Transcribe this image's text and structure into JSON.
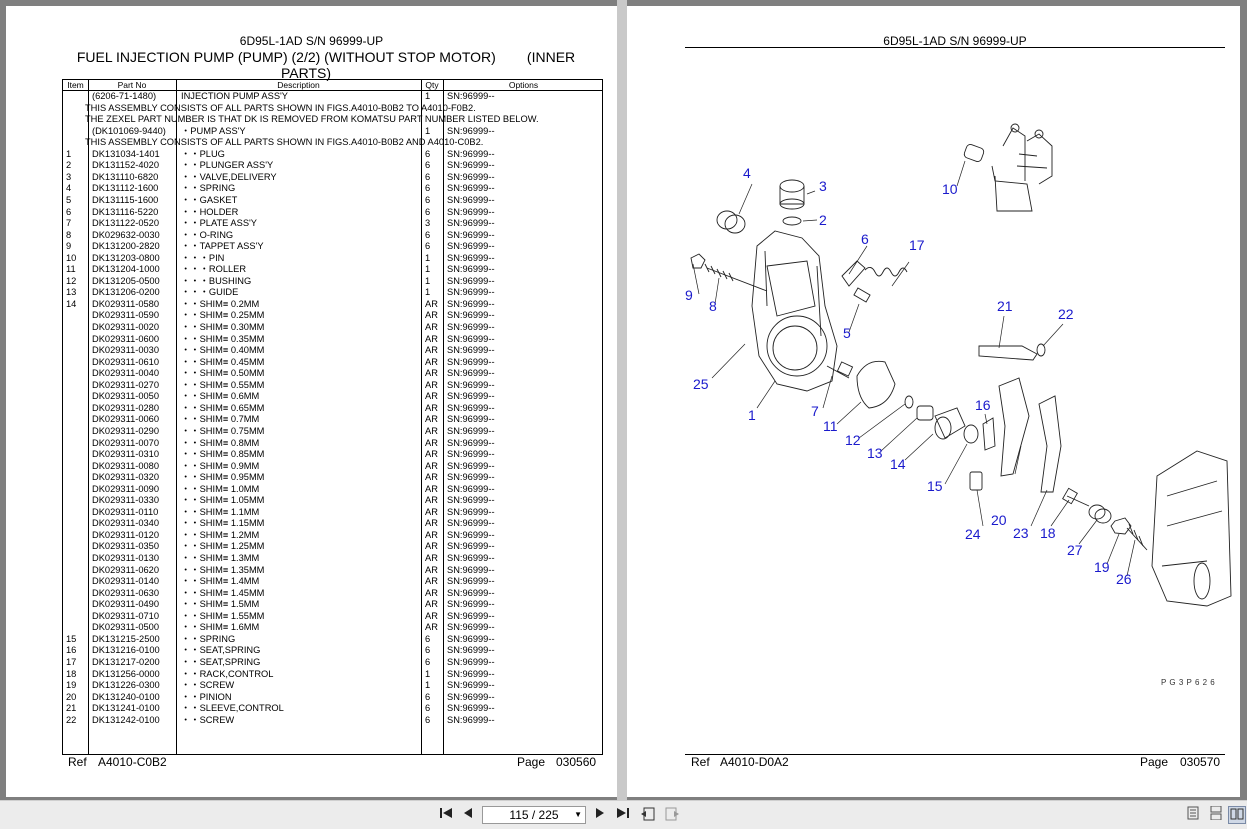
{
  "left_page": {
    "model_header": "6D95L-1AD S/N 96999-UP",
    "title_line1": "FUEL INJECTION PUMP (PUMP) (2/2) (WITHOUT STOP MOTOR)        (INNER",
    "title_line2": "PARTS)",
    "columns": {
      "item": "Item",
      "part_no": "Part No",
      "description": "Description",
      "qty": "Qty",
      "options": "Options"
    },
    "rows": [
      {
        "item": "",
        "part": "(6206-71-1480)",
        "desc": "INJECTION PUMP ASS'Y",
        "qty": "1",
        "opt": "SN:96999--"
      },
      {
        "note": "THIS ASSEMBLY CONSISTS OF ALL PARTS SHOWN IN FIGS.A4010-B0B2 TO A4010-F0B2."
      },
      {
        "note": "THE ZEXEL PART NUMBER IS THAT DK IS REMOVED FROM KOMATSU PART NUMBER LISTED BELOW."
      },
      {
        "item": "",
        "part": "(DK101069-9440)",
        "desc": "・PUMP ASS'Y",
        "qty": "1",
        "opt": "SN:96999--"
      },
      {
        "note": "THIS ASSEMBLY CONSISTS OF ALL PARTS SHOWN IN FIGS.A4010-B0B2 AND A4010-C0B2."
      },
      {
        "item": "1",
        "part": "DK131034-1401",
        "desc": "・・PLUG",
        "qty": "6",
        "opt": "SN:96999--"
      },
      {
        "item": "2",
        "part": "DK131152-4020",
        "desc": "・・PLUNGER ASS'Y",
        "qty": "6",
        "opt": "SN:96999--"
      },
      {
        "item": "3",
        "part": "DK131110-6820",
        "desc": "・・VALVE,DELIVERY",
        "qty": "6",
        "opt": "SN:96999--"
      },
      {
        "item": "4",
        "part": "DK131112-1600",
        "desc": "・・SPRING",
        "qty": "6",
        "opt": "SN:96999--"
      },
      {
        "item": "5",
        "part": "DK131115-1600",
        "desc": "・・GASKET",
        "qty": "6",
        "opt": "SN:96999--"
      },
      {
        "item": "6",
        "part": "DK131116-5220",
        "desc": "・・HOLDER",
        "qty": "6",
        "opt": "SN:96999--"
      },
      {
        "item": "7",
        "part": "DK131122-0520",
        "desc": "・・PLATE ASS'Y",
        "qty": "3",
        "opt": "SN:96999--"
      },
      {
        "item": "8",
        "part": "DK029632-0030",
        "desc": "・・O-RING",
        "qty": "6",
        "opt": "SN:96999--"
      },
      {
        "item": "9",
        "part": "DK131200-2820",
        "desc": "・・TAPPET ASS'Y",
        "qty": "6",
        "opt": "SN:96999--"
      },
      {
        "item": "10",
        "part": "DK131203-0800",
        "desc": "・・・PIN",
        "qty": "1",
        "opt": "SN:96999--"
      },
      {
        "item": "11",
        "part": "DK131204-1000",
        "desc": "・・・ROLLER",
        "qty": "1",
        "opt": "SN:96999--"
      },
      {
        "item": "12",
        "part": "DK131205-0500",
        "desc": "・・・BUSHING",
        "qty": "1",
        "opt": "SN:96999--"
      },
      {
        "item": "13",
        "part": "DK131206-0200",
        "desc": "・・・GUIDE",
        "qty": "1",
        "opt": "SN:96999--"
      },
      {
        "item": "14",
        "part": "DK029311-0580",
        "desc": "・・SHIM≡ 0.2MM",
        "qty": "AR",
        "opt": "SN:96999--"
      },
      {
        "item": "",
        "part": "DK029311-0590",
        "desc": "・・SHIM≡ 0.25MM",
        "qty": "AR",
        "opt": "SN:96999--"
      },
      {
        "item": "",
        "part": "DK029311-0020",
        "desc": "・・SHIM≡ 0.30MM",
        "qty": "AR",
        "opt": "SN:96999--"
      },
      {
        "item": "",
        "part": "DK029311-0600",
        "desc": "・・SHIM≡ 0.35MM",
        "qty": "AR",
        "opt": "SN:96999--"
      },
      {
        "item": "",
        "part": "DK029311-0030",
        "desc": "・・SHIM≡ 0.40MM",
        "qty": "AR",
        "opt": "SN:96999--"
      },
      {
        "item": "",
        "part": "DK029311-0610",
        "desc": "・・SHIM≡ 0.45MM",
        "qty": "AR",
        "opt": "SN:96999--"
      },
      {
        "item": "",
        "part": "DK029311-0040",
        "desc": "・・SHIM≡ 0.50MM",
        "qty": "AR",
        "opt": "SN:96999--"
      },
      {
        "item": "",
        "part": "DK029311-0270",
        "desc": "・・SHIM≡ 0.55MM",
        "qty": "AR",
        "opt": "SN:96999--"
      },
      {
        "item": "",
        "part": "DK029311-0050",
        "desc": "・・SHIM≡ 0.6MM",
        "qty": "AR",
        "opt": "SN:96999--"
      },
      {
        "item": "",
        "part": "DK029311-0280",
        "desc": "・・SHIM≡ 0.65MM",
        "qty": "AR",
        "opt": "SN:96999--"
      },
      {
        "item": "",
        "part": "DK029311-0060",
        "desc": "・・SHIM≡ 0.7MM",
        "qty": "AR",
        "opt": "SN:96999--"
      },
      {
        "item": "",
        "part": "DK029311-0290",
        "desc": "・・SHIM≡ 0.75MM",
        "qty": "AR",
        "opt": "SN:96999--"
      },
      {
        "item": "",
        "part": "DK029311-0070",
        "desc": "・・SHIM≡ 0.8MM",
        "qty": "AR",
        "opt": "SN:96999--"
      },
      {
        "item": "",
        "part": "DK029311-0310",
        "desc": "・・SHIM≡ 0.85MM",
        "qty": "AR",
        "opt": "SN:96999--"
      },
      {
        "item": "",
        "part": "DK029311-0080",
        "desc": "・・SHIM≡ 0.9MM",
        "qty": "AR",
        "opt": "SN:96999--"
      },
      {
        "item": "",
        "part": "DK029311-0320",
        "desc": "・・SHIM≡ 0.95MM",
        "qty": "AR",
        "opt": "SN:96999--"
      },
      {
        "item": "",
        "part": "DK029311-0090",
        "desc": "・・SHIM≡ 1.0MM",
        "qty": "AR",
        "opt": "SN:96999--"
      },
      {
        "item": "",
        "part": "DK029311-0330",
        "desc": "・・SHIM≡ 1.05MM",
        "qty": "AR",
        "opt": "SN:96999--"
      },
      {
        "item": "",
        "part": "DK029311-0110",
        "desc": "・・SHIM≡ 1.1MM",
        "qty": "AR",
        "opt": "SN:96999--"
      },
      {
        "item": "",
        "part": "DK029311-0340",
        "desc": "・・SHIM≡ 1.15MM",
        "qty": "AR",
        "opt": "SN:96999--"
      },
      {
        "item": "",
        "part": "DK029311-0120",
        "desc": "・・SHIM≡ 1.2MM",
        "qty": "AR",
        "opt": "SN:96999--"
      },
      {
        "item": "",
        "part": "DK029311-0350",
        "desc": "・・SHIM≡ 1.25MM",
        "qty": "AR",
        "opt": "SN:96999--"
      },
      {
        "item": "",
        "part": "DK029311-0130",
        "desc": "・・SHIM≡ 1.3MM",
        "qty": "AR",
        "opt": "SN:96999--"
      },
      {
        "item": "",
        "part": "DK029311-0620",
        "desc": "・・SHIM≡ 1.35MM",
        "qty": "AR",
        "opt": "SN:96999--"
      },
      {
        "item": "",
        "part": "DK029311-0140",
        "desc": "・・SHIM≡ 1.4MM",
        "qty": "AR",
        "opt": "SN:96999--"
      },
      {
        "item": "",
        "part": "DK029311-0630",
        "desc": "・・SHIM≡ 1.45MM",
        "qty": "AR",
        "opt": "SN:96999--"
      },
      {
        "item": "",
        "part": "DK029311-0490",
        "desc": "・・SHIM≡ 1.5MM",
        "qty": "AR",
        "opt": "SN:96999--"
      },
      {
        "item": "",
        "part": "DK029311-0710",
        "desc": "・・SHIM≡ 1.55MM",
        "qty": "AR",
        "opt": "SN:96999--"
      },
      {
        "item": "",
        "part": "DK029311-0500",
        "desc": "・・SHIM≡ 1.6MM",
        "qty": "AR",
        "opt": "SN:96999--"
      },
      {
        "item": "15",
        "part": "DK131215-2500",
        "desc": "・・SPRING",
        "qty": "6",
        "opt": "SN:96999--"
      },
      {
        "item": "16",
        "part": "DK131216-0100",
        "desc": "・・SEAT,SPRING",
        "qty": "6",
        "opt": "SN:96999--"
      },
      {
        "item": "17",
        "part": "DK131217-0200",
        "desc": "・・SEAT,SPRING",
        "qty": "6",
        "opt": "SN:96999--"
      },
      {
        "item": "18",
        "part": "DK131256-0000",
        "desc": "・・RACK,CONTROL",
        "qty": "1",
        "opt": "SN:96999--"
      },
      {
        "item": "19",
        "part": "DK131226-0300",
        "desc": "・・SCREW",
        "qty": "1",
        "opt": "SN:96999--"
      },
      {
        "item": "20",
        "part": "DK131240-0100",
        "desc": "・・PINION",
        "qty": "6",
        "opt": "SN:96999--"
      },
      {
        "item": "21",
        "part": "DK131241-0100",
        "desc": "・・SLEEVE,CONTROL",
        "qty": "6",
        "opt": "SN:96999--"
      },
      {
        "item": "22",
        "part": "DK131242-0100",
        "desc": "・・SCREW",
        "qty": "6",
        "opt": "SN:96999--"
      }
    ],
    "ref_label": "Ref",
    "ref_value": "A4010-C0B2",
    "page_label": "Page",
    "page_value": "030560"
  },
  "right_page": {
    "model_header": "6D95L-1AD S/N 96999-UP",
    "callouts": [
      "1",
      "2",
      "3",
      "4",
      "5",
      "6",
      "7",
      "8",
      "9",
      "10",
      "11",
      "12",
      "13",
      "14",
      "15",
      "16",
      "17",
      "18",
      "19",
      "20",
      "21",
      "22",
      "23",
      "24",
      "25",
      "26",
      "27"
    ],
    "drawing_code": "P G 3 P 6 2 6",
    "ref_label": "Ref",
    "ref_value": "A4010-D0A2",
    "page_label": "Page",
    "page_value": "030570"
  },
  "toolbar": {
    "page_indicator": "115 / 225",
    "first_icon": "first-page-icon",
    "prev_icon": "previous-page-icon",
    "next_icon": "next-page-icon",
    "last_icon": "last-page-icon"
  },
  "colors": {
    "callout": "#1a1acc",
    "background": "#7f7f7f"
  }
}
